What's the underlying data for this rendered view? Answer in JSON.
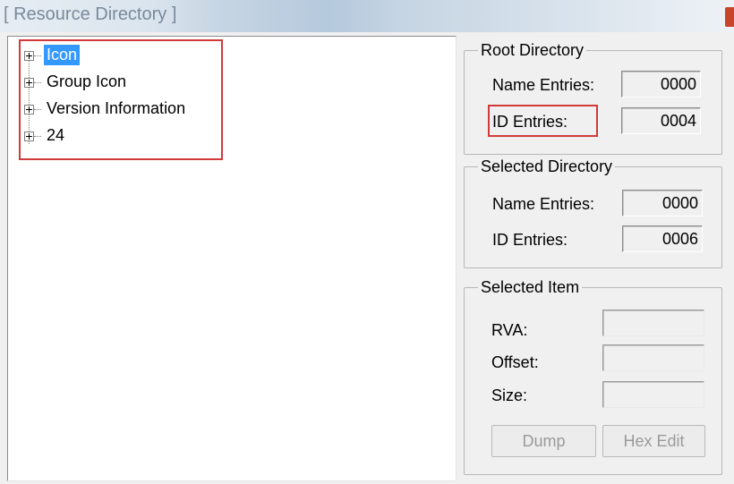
{
  "window": {
    "title": "[ Resource Directory ]"
  },
  "tree": {
    "items": [
      {
        "label": "Icon",
        "selected": true
      },
      {
        "label": "Group Icon",
        "selected": false
      },
      {
        "label": "Version Information",
        "selected": false
      },
      {
        "label": "24",
        "selected": false
      }
    ]
  },
  "root_directory": {
    "title": "Root Directory",
    "name_entries_label": "Name Entries:",
    "name_entries_value": "0000",
    "id_entries_label": "ID Entries:",
    "id_entries_value": "0004"
  },
  "selected_directory": {
    "title": "Selected Directory",
    "name_entries_label": "Name Entries:",
    "name_entries_value": "0000",
    "id_entries_label": "ID Entries:",
    "id_entries_value": "0006"
  },
  "selected_item": {
    "title": "Selected Item",
    "rva_label": "RVA:",
    "rva_value": "",
    "offset_label": "Offset:",
    "offset_value": "",
    "size_label": "Size:",
    "size_value": "",
    "dump_label": "Dump",
    "hex_edit_label": "Hex Edit"
  },
  "colors": {
    "selection": "#3399ff",
    "highlight_annotation": "#d23a3a"
  }
}
